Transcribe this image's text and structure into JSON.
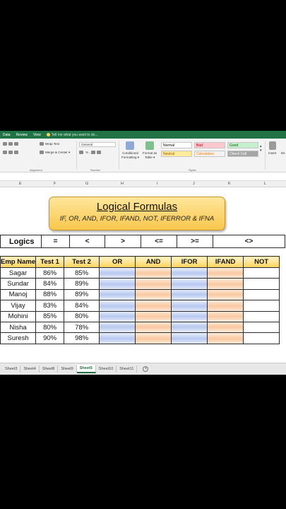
{
  "menubar": {
    "items": [
      "Data",
      "Review",
      "View"
    ],
    "tell_me": "Tell me what you want to do..."
  },
  "ribbon": {
    "wrap_text": "Wrap Text",
    "merge_center": "Merge & Center",
    "number_format": "General",
    "percent": "%",
    "comma": ",",
    "conditional_formatting": "Conditional",
    "conditional_formatting_2": "Formatting",
    "format_as_table": "Format as",
    "format_as_table_2": "Table",
    "styles": [
      {
        "label": "Normal",
        "bg": "#ffffff",
        "color": "#000000"
      },
      {
        "label": "Bad",
        "bg": "#ffc7ce",
        "color": "#9c0006"
      },
      {
        "label": "Good",
        "bg": "#c6efce",
        "color": "#006100"
      },
      {
        "label": "Neutral",
        "bg": "#ffeb9c",
        "color": "#9c5700"
      },
      {
        "label": "Calculation",
        "bg": "#f2f2f2",
        "color": "#fa7d00"
      },
      {
        "label": "Check Cell",
        "bg": "#a5a5a5",
        "color": "#ffffff"
      }
    ],
    "insert": "Insert",
    "groups": {
      "alignment": "Alignment",
      "number": "Number",
      "styles": "Styles"
    }
  },
  "columns": [
    "E",
    "F",
    "G",
    "H",
    "I",
    "J",
    "K",
    "L"
  ],
  "banner": {
    "title": "Logical Formulas",
    "subtitle": "IF, OR, AND, IFOR, IFAND, NOT, IFERROR & IFNA"
  },
  "logics": {
    "label": "Logics",
    "operators": [
      "=",
      "<",
      ">",
      "<=",
      ">=",
      "<>"
    ]
  },
  "table": {
    "headers": [
      "Emp Name",
      "Test 1",
      "Test 2",
      "OR",
      "AND",
      "IFOR",
      "IFAND",
      "NOT"
    ],
    "rows": [
      [
        "Sagar",
        "86%",
        "85%"
      ],
      [
        "Sundar",
        "84%",
        "89%"
      ],
      [
        "Manoj",
        "88%",
        "89%"
      ],
      [
        "Vijay",
        "83%",
        "84%"
      ],
      [
        "Mohini",
        "85%",
        "80%"
      ],
      [
        "Nisha",
        "80%",
        "78%"
      ],
      [
        "Suresh",
        "90%",
        "98%"
      ]
    ]
  },
  "sheet_tabs": [
    "Sheet3",
    "Sheet4",
    "Sheet8",
    "Sheet9",
    "Sheet5",
    "Sheet10",
    "Sheet11"
  ],
  "active_tab": "Sheet5",
  "colors": {
    "excel_green": "#217346",
    "banner": "#f8c74d",
    "header_fill": "#ffd45a",
    "blue_col": "#b7c8ef",
    "orange_col": "#f9c8a0"
  }
}
